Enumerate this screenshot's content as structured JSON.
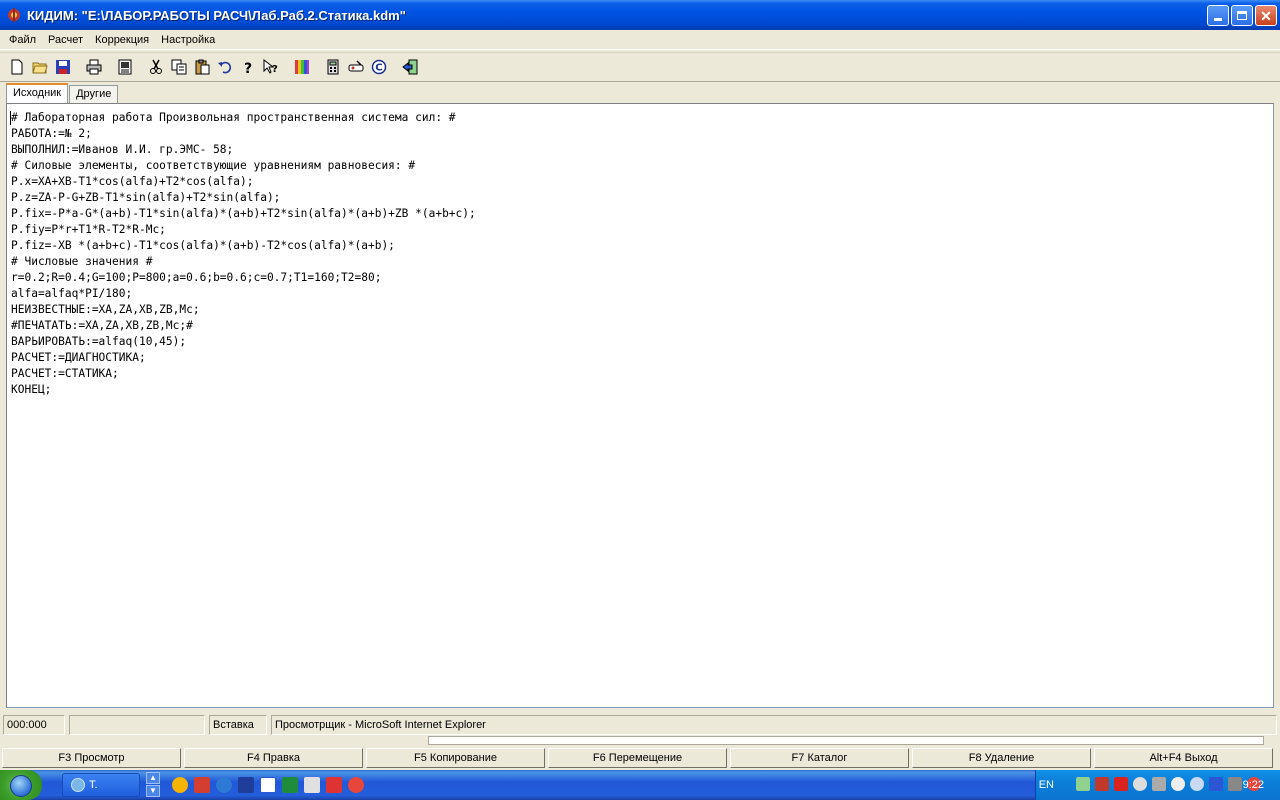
{
  "window": {
    "title": "КИДИМ: \"E:\\ЛАБОР.РАБОТЫ РАСЧ\\Лаб.Раб.2.Статика.kdm\""
  },
  "menu": [
    "Файл",
    "Расчет",
    "Коррекция",
    "Настройка"
  ],
  "toolbar": {
    "icons": [
      "new-file-icon",
      "open-folder-icon",
      "save-icon",
      "print-icon",
      "preview-icon",
      "cut-icon",
      "copy-icon",
      "paste-icon",
      "undo-icon",
      "help-icon",
      "context-help-icon",
      "palette-icon",
      "calculator-icon",
      "tools-icon",
      "copyright-icon",
      "exit-icon"
    ]
  },
  "tabs": [
    "Исходник",
    "Другие"
  ],
  "editor": {
    "lines": [
      "# Лабораторная работа Произвольная пространственная система сил: #",
      "РАБОТА:=№ 2;",
      "ВЫПОЛНИЛ:=Иванов И.И. гр.ЭМС- 58;",
      "# Силовые элементы, соответствующие уравнениям равновесия: #",
      "P.x=XA+XB-T1*cos(alfa)+T2*cos(alfa);",
      "P.z=ZA-P-G+ZB-T1*sin(alfa)+T2*sin(alfa);",
      "P.fix=-P*a-G*(a+b)-T1*sin(alfa)*(a+b)+T2*sin(alfa)*(a+b)+ZB *(a+b+c);",
      "P.fiy=P*r+T1*R-T2*R-Mc;",
      "P.fiz=-XB *(a+b+c)-T1*cos(alfa)*(a+b)-T2*cos(alfa)*(a+b);",
      "# Числовые значения #",
      "r=0.2;R=0.4;G=100;P=800;a=0.6;b=0.6;c=0.7;T1=160;T2=80;",
      "alfa=alfaq*PI/180;",
      "НЕИЗВЕСТНЫЕ:=XA,ZA,XB,ZB,Mc;",
      "#ПЕЧАТАТЬ:=XA,ZA,XB,ZB,Mc;#",
      "ВАРЬИРОВАТЬ:=alfaq(10,45);",
      "РАСЧЕТ:=ДИАГНОСТИКА;",
      "РАСЧЕТ:=СТАТИКА;",
      "КОНЕЦ;"
    ]
  },
  "status": {
    "position": "000:000",
    "empty": "",
    "mode": "Вставка",
    "viewer": "Просмотрщик - MicroSoft Internet Explorer"
  },
  "fkeys": [
    "F3 Просмотр",
    "F4 Правка",
    "F5 Копирование",
    "F6 Перемещение",
    "F7 Каталог",
    "F8 Удаление",
    "Alt+F4 Выход"
  ],
  "taskbar": {
    "task_label": "Т.",
    "lang": "EN",
    "clock": "9:22"
  },
  "colors": {
    "titlebar": "#0054e3",
    "taskbar": "#245edb",
    "start": "#3c9d2a"
  }
}
